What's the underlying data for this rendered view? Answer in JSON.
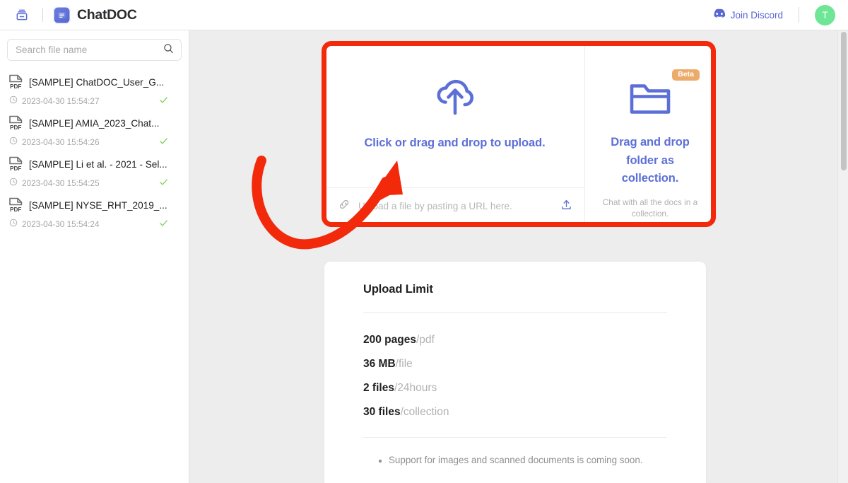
{
  "header": {
    "archive_icon": "archive-icon",
    "brand_name": "ChatDOC",
    "brand_icon": "chatdoc-logo-icon",
    "discord_label": "Join Discord",
    "discord_icon": "discord-icon",
    "avatar_initial": "T",
    "avatar_color": "#6ee695"
  },
  "sidebar": {
    "search": {
      "placeholder": "Search file name",
      "value": "",
      "icon": "search-icon"
    },
    "files": [
      {
        "name": "[SAMPLE] ChatDOC_User_G...",
        "time": "2023-04-30 15:54:27",
        "type_label": "PDF",
        "status": "done"
      },
      {
        "name": "[SAMPLE] AMIA_2023_Chat...",
        "time": "2023-04-30 15:54:26",
        "type_label": "PDF",
        "status": "done"
      },
      {
        "name": "[SAMPLE] Li et al. - 2021 - Sel...",
        "time": "2023-04-30 15:54:25",
        "type_label": "PDF",
        "status": "done"
      },
      {
        "name": "[SAMPLE] NYSE_RHT_2019_...",
        "time": "2023-04-30 15:54:24",
        "type_label": "PDF",
        "status": "done"
      }
    ]
  },
  "main": {
    "upload": {
      "dropzone_label": "Click or drag and drop to upload.",
      "dropzone_icon": "cloud-upload-icon",
      "url_placeholder": "Upload a file by pasting a URL here.",
      "url_value": "",
      "link_icon": "link-icon",
      "submit_icon": "upload-arrow-icon",
      "folder_badge": "Beta",
      "folder_icon": "folder-icon",
      "folder_title": "Drag and drop folder as collection.",
      "folder_sub": "Chat with all the docs in a collection."
    },
    "limit": {
      "title": "Upload Limit",
      "rows": [
        {
          "num": "200 pages",
          "unit": "/pdf"
        },
        {
          "num": "36 MB",
          "unit": "/file"
        },
        {
          "num": "2 files",
          "unit": "/24hours"
        },
        {
          "num": "30 files",
          "unit": "/collection"
        }
      ],
      "notes": [
        "Support for images and scanned documents is coming soon."
      ]
    }
  },
  "annotation": {
    "highlight_color": "#f3290b",
    "shape": "rounded-rectangle-with-curved-arrow"
  },
  "colors": {
    "accent_blue": "#5c6fd6",
    "badge_orange": "#edab69",
    "check_green": "#84cf5e",
    "annotation_red": "#f3290b"
  }
}
